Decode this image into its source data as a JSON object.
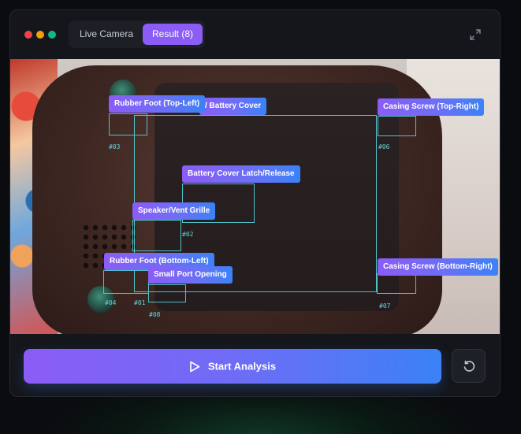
{
  "window": {
    "controls": [
      "close",
      "minimize",
      "maximize"
    ]
  },
  "tabs": [
    {
      "label": "Live Camera",
      "active": false
    },
    {
      "label": "Result (8)",
      "active": true
    }
  ],
  "icons": {
    "expand": "expand-icon",
    "play": "play-icon",
    "reset": "rotate-ccw-icon"
  },
  "detections": [
    {
      "id": "#01",
      "label": "/ Battery Cover"
    },
    {
      "id": "#02",
      "label": "Battery Cover Latch/Release"
    },
    {
      "id": "#03",
      "label": "Rubber Foot (Top-Left)"
    },
    {
      "id": "#04",
      "label": "Rubber Foot (Bottom-Left)"
    },
    {
      "id": "#05",
      "label": "Speaker/Vent Grille"
    },
    {
      "id": "#06",
      "label": "Casing Screw (Top-Right)"
    },
    {
      "id": "#07",
      "label": "Casing Screw (Bottom-Right)"
    },
    {
      "id": "#08",
      "label": "Small Port Opening"
    }
  ],
  "actions": {
    "start_label": "Start Analysis"
  },
  "colors": {
    "accent_purple": "#8b5cf6",
    "accent_blue": "#3b82f6",
    "box_cyan": "#4fc3c7"
  }
}
